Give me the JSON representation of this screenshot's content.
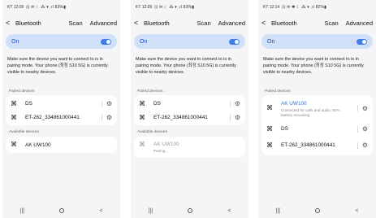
{
  "screens": [
    {
      "status": {
        "time": "KT 12:09",
        "icons": "⊡ ✉ ☾ ⁂ ▾ .ıl 83%▮"
      },
      "header": {
        "title": "Bluetooth",
        "scan": "Scan",
        "advanced": "Advanced",
        "back": "<"
      },
      "on_label": "On",
      "description": "Make sure the device you want to connect to is in pairing mode. Your phone (최정 S10 5G) is currently visible to nearby devices.",
      "paired_label": "Paired devices",
      "paired": [
        {
          "name": "DS"
        },
        {
          "name": "ET-262_334861000441"
        }
      ],
      "available_label": "Available devices",
      "available": [
        {
          "name": "AK UW100"
        }
      ],
      "nav": {
        "recent": "|||",
        "back": "<"
      }
    },
    {
      "status": {
        "time": "KT 12:09",
        "icons": "⊡ ✉ ☾ ⁂ ▾ .ıl 83%▮"
      },
      "header": {
        "title": "Bluetooth",
        "scan": "Scan",
        "advanced": "Advanced",
        "back": "<"
      },
      "on_label": "On",
      "description": "Make sure the device you want to connect to is in pairing mode. Your phone (최정 S10 5G) is currently visible to nearby devices.",
      "paired_label": "Paired devices",
      "paired": [
        {
          "name": "DS"
        },
        {
          "name": "ET-262_334861000441"
        }
      ],
      "available_label": "Available devices",
      "available": [
        {
          "name": "AK UW100",
          "status": "Pairing..."
        }
      ],
      "nav": {
        "recent": "|||",
        "back": "<"
      }
    },
    {
      "status": {
        "time": "KT 12:14",
        "icons": "⊡ ✉ ✱ ☾ ⁂ ▾ .ıl 82%▮"
      },
      "header": {
        "title": "Bluetooth",
        "scan": "Scan",
        "advanced": "Advanced",
        "back": "<"
      },
      "on_label": "On",
      "description": "Make sure the device you want to connect to is in pairing mode. Your phone (최정 S10 5G) is currently visible to nearby devices.",
      "paired_label": "Paired devices",
      "paired": [
        {
          "name": "AK UW100",
          "status": "Connected for calls and audio, 92% battery remaining"
        },
        {
          "name": "DS"
        },
        {
          "name": "ET-262_334861000441"
        }
      ],
      "nav": {
        "recent": "|||",
        "back": "<"
      }
    }
  ],
  "colors": {
    "accent": "#3e7ee6",
    "on_bar": "#cfe0f8",
    "connected_name": "#2d6fd6",
    "screen_bg": "#f5f5f7"
  },
  "icons": {
    "device": "device-grid-icon",
    "settings": "gear-icon",
    "back": "back-arrow-icon"
  }
}
